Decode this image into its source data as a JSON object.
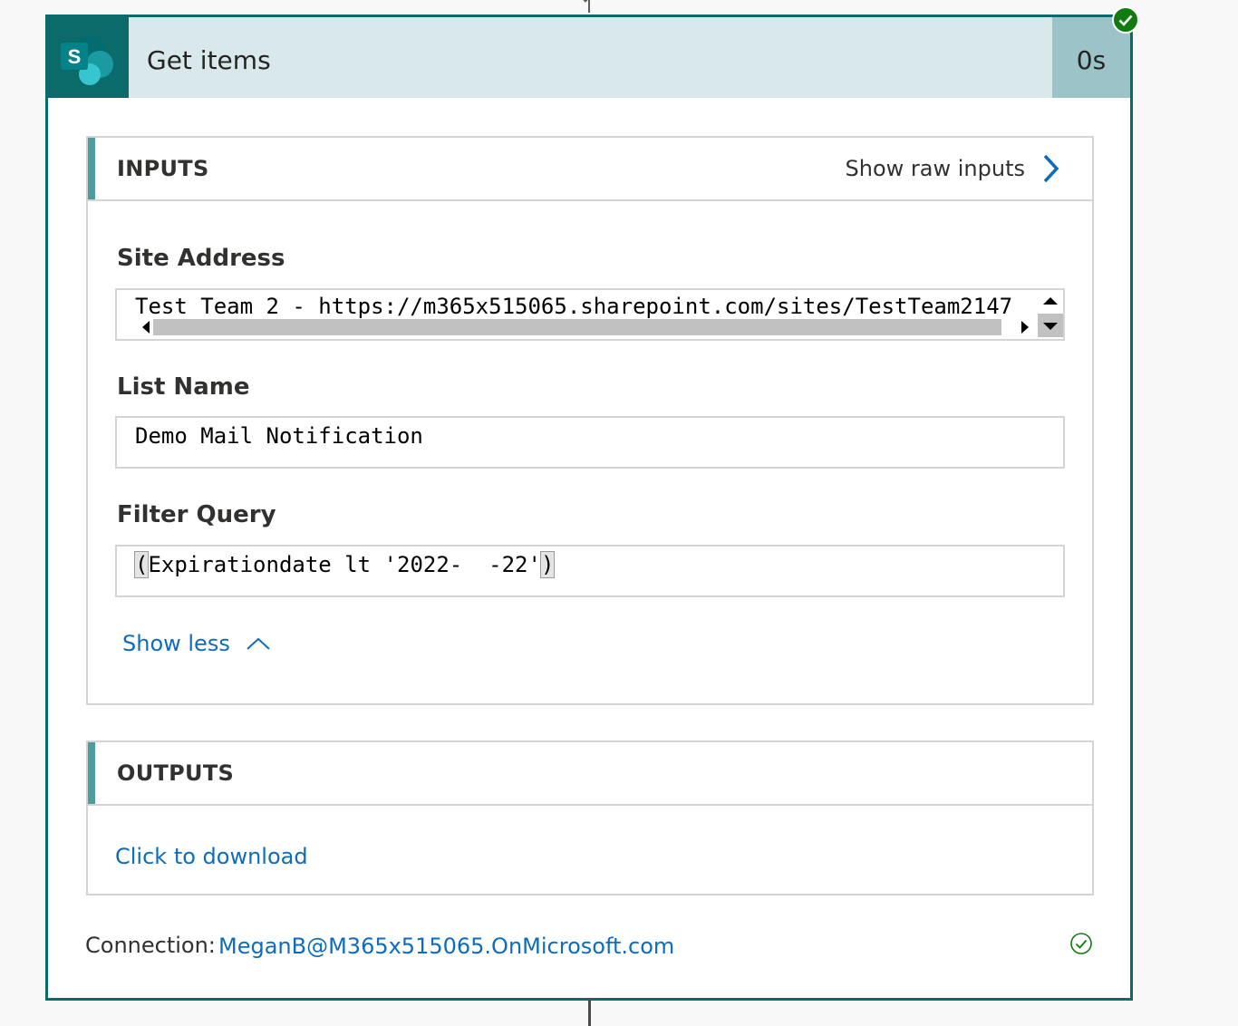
{
  "action": {
    "title": "Get items",
    "duration": "0s",
    "icon_letter": "S",
    "status_icon": "check-circle-icon"
  },
  "inputs": {
    "heading": "INPUTS",
    "show_raw_label": "Show raw inputs",
    "fields": [
      {
        "label": "Site Address",
        "value": "Test Team 2 - https://m365x515065.sharepoint.com/sites/TestTeam2147"
      },
      {
        "label": "List Name",
        "value": "Demo Mail Notification"
      },
      {
        "label": "Filter Query",
        "value_open": "(",
        "value_body": "Expirationdate lt '2022-  -22'",
        "value_close": ")"
      }
    ],
    "show_less_label": "Show less"
  },
  "outputs": {
    "heading": "OUTPUTS",
    "download_label": "Click to download"
  },
  "connection": {
    "label": "Connection:",
    "value": "MeganB@M365x515065.OnMicrosoft.com"
  },
  "colors": {
    "accent": "#0b6a6a",
    "header_bg": "#d9e8ea",
    "link": "#0f6cbd",
    "success": "#107c10"
  }
}
